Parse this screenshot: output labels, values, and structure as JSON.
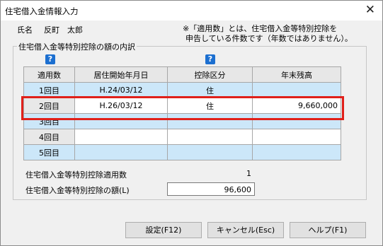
{
  "window": {
    "title": "住宅借入金情報入力",
    "close_glyph": "✕"
  },
  "person": {
    "label": "氏名",
    "name": "反町　太郎"
  },
  "note": {
    "line1": "※「適用数」とは、住宅借入金等特別控除を",
    "line2": "申告している件数です（年数ではありません）。"
  },
  "group": {
    "legend": "住宅借入金等特別控除の額の内訳"
  },
  "help_glyph": "?",
  "table": {
    "headers": [
      "適用数",
      "居住開始年月日",
      "控除区分",
      "年末残高"
    ],
    "rows": [
      {
        "num": "1回目",
        "date": "H.24/03/12",
        "type": "住",
        "balance": ""
      },
      {
        "num": "2回目",
        "date": "H.26/03/12",
        "type": "住",
        "balance": "9,660,000"
      },
      {
        "num": "3回目",
        "date": "",
        "type": "",
        "balance": ""
      },
      {
        "num": "4回目",
        "date": "",
        "type": "",
        "balance": ""
      },
      {
        "num": "5回目",
        "date": "",
        "type": "",
        "balance": ""
      }
    ]
  },
  "summary": {
    "count_label": "住宅借入金等特別控除適用数",
    "count_value": "1",
    "amount_label": "住宅借入金等特別控除の額(L)",
    "amount_value": "96,600"
  },
  "buttons": {
    "settings": "設定(F12)",
    "cancel": "キャンセル(Esc)",
    "help": "ヘルプ(F1)"
  },
  "colors": {
    "highlight": "#e0201a",
    "row_blue": "#cce7f9",
    "help_icon": "#1c6fd0"
  }
}
